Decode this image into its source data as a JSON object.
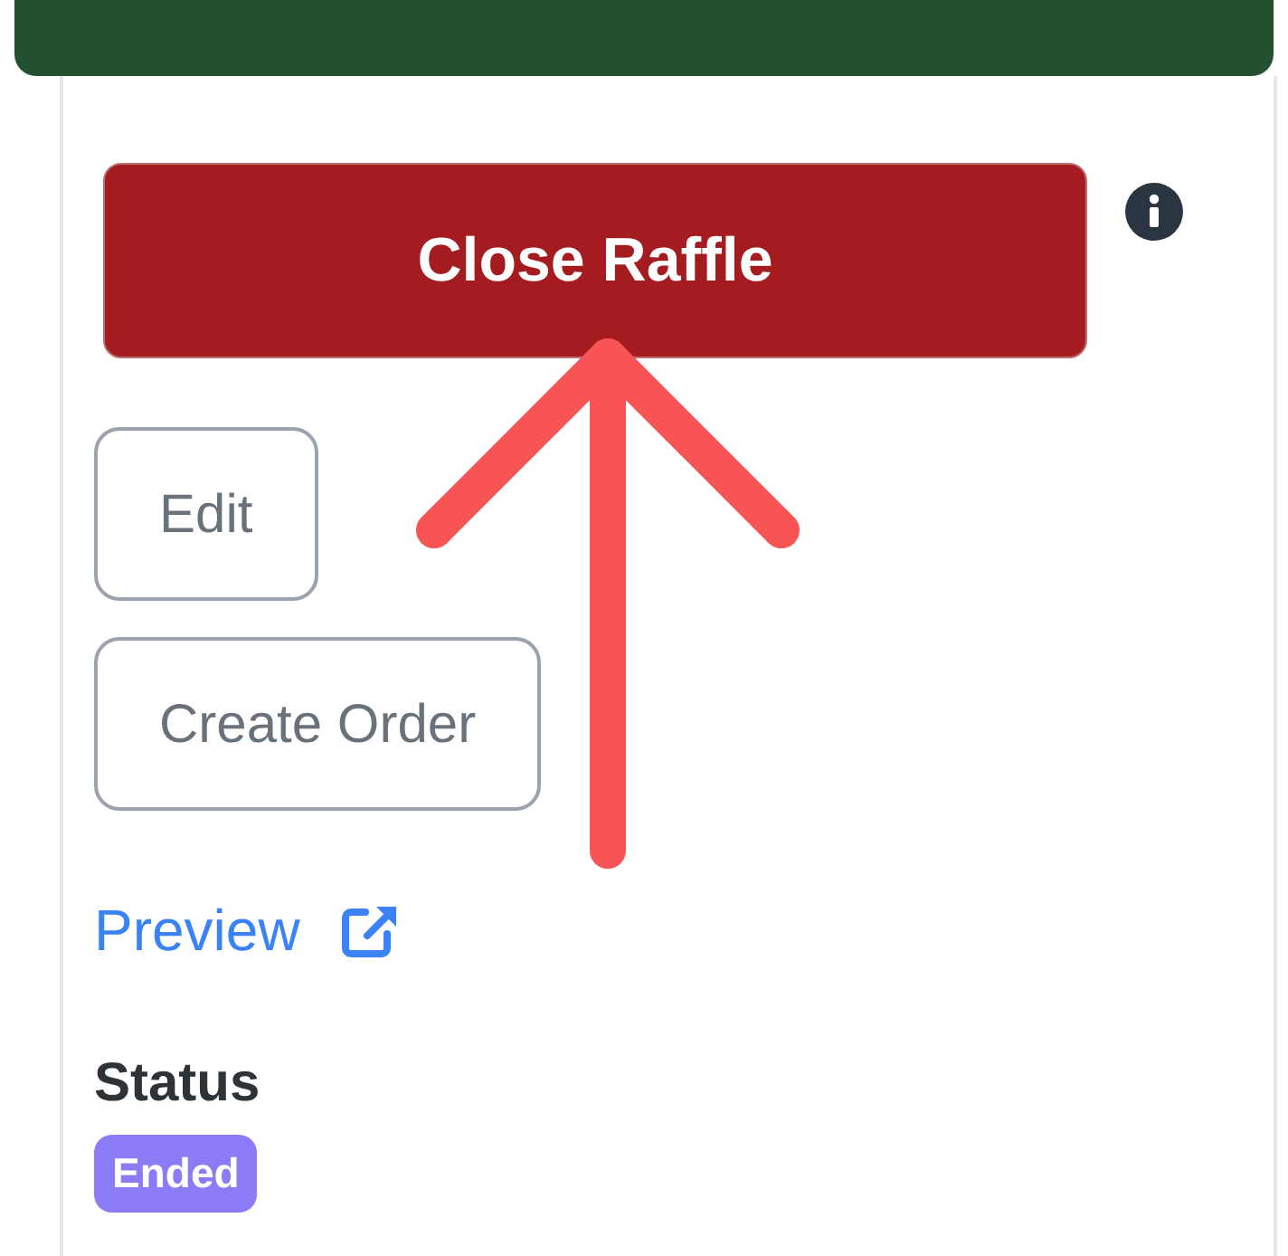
{
  "primary_button": {
    "label": "Close Raffle"
  },
  "buttons": [
    {
      "label": "Edit"
    },
    {
      "label": "Create Order"
    }
  ],
  "preview_link": {
    "label": "Preview"
  },
  "status": {
    "label": "Status",
    "badge": "Ended",
    "color": "#8b7cf6"
  }
}
